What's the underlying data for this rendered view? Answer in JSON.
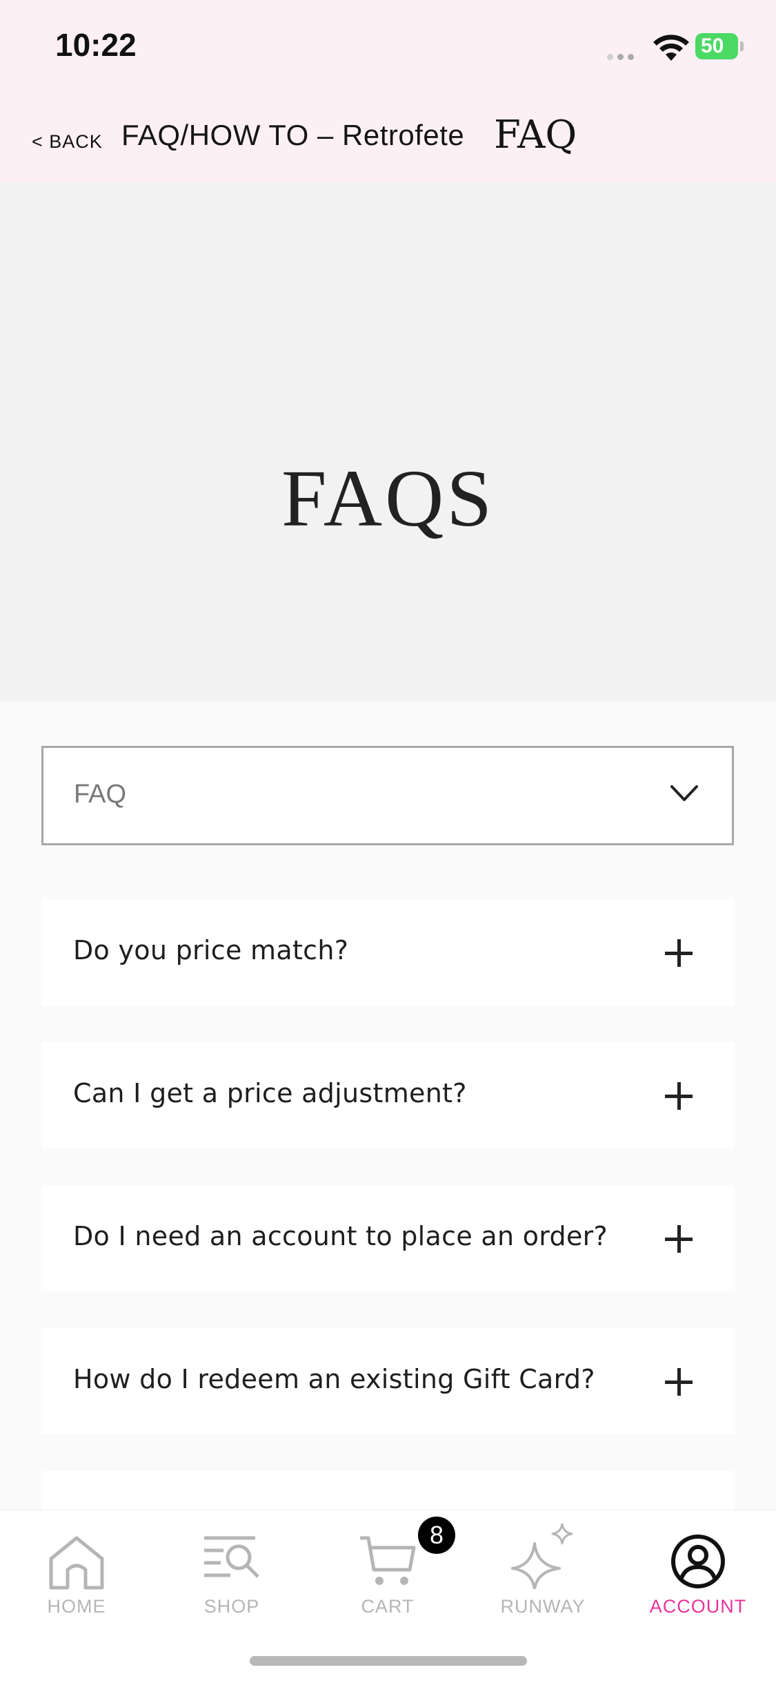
{
  "status_bar": {
    "time": "10:22",
    "battery": "50"
  },
  "header": {
    "back_label": "< BACK",
    "title": "FAQ/HOW TO – Retrofete",
    "logo": "FAQ"
  },
  "hero": {
    "title": "FAQS"
  },
  "filter": {
    "selected": "FAQ",
    "icon": "chevron-down-icon"
  },
  "faq_items": [
    {
      "question": "Do you price match?"
    },
    {
      "question": "Can I get a price adjustment?"
    },
    {
      "question": "Do I need an account to place an order?"
    },
    {
      "question": "How do I redeem an existing Gift Card?"
    }
  ],
  "tabbar": {
    "tabs": [
      {
        "label": "HOME",
        "icon": "home-icon"
      },
      {
        "label": "SHOP",
        "icon": "shop-search-icon"
      },
      {
        "label": "CART",
        "icon": "cart-icon"
      },
      {
        "label": "RUNWAY",
        "icon": "sparkle-icon"
      },
      {
        "label": "ACCOUNT",
        "icon": "account-icon"
      }
    ],
    "cart_badge": "8",
    "active_color": "#e8339a",
    "inactive_color": "#b5b5b5"
  },
  "colors": {
    "header_bg": "#fdf0f5",
    "hero_bg": "#f2f2f2",
    "page_bg": "#fafafa"
  }
}
